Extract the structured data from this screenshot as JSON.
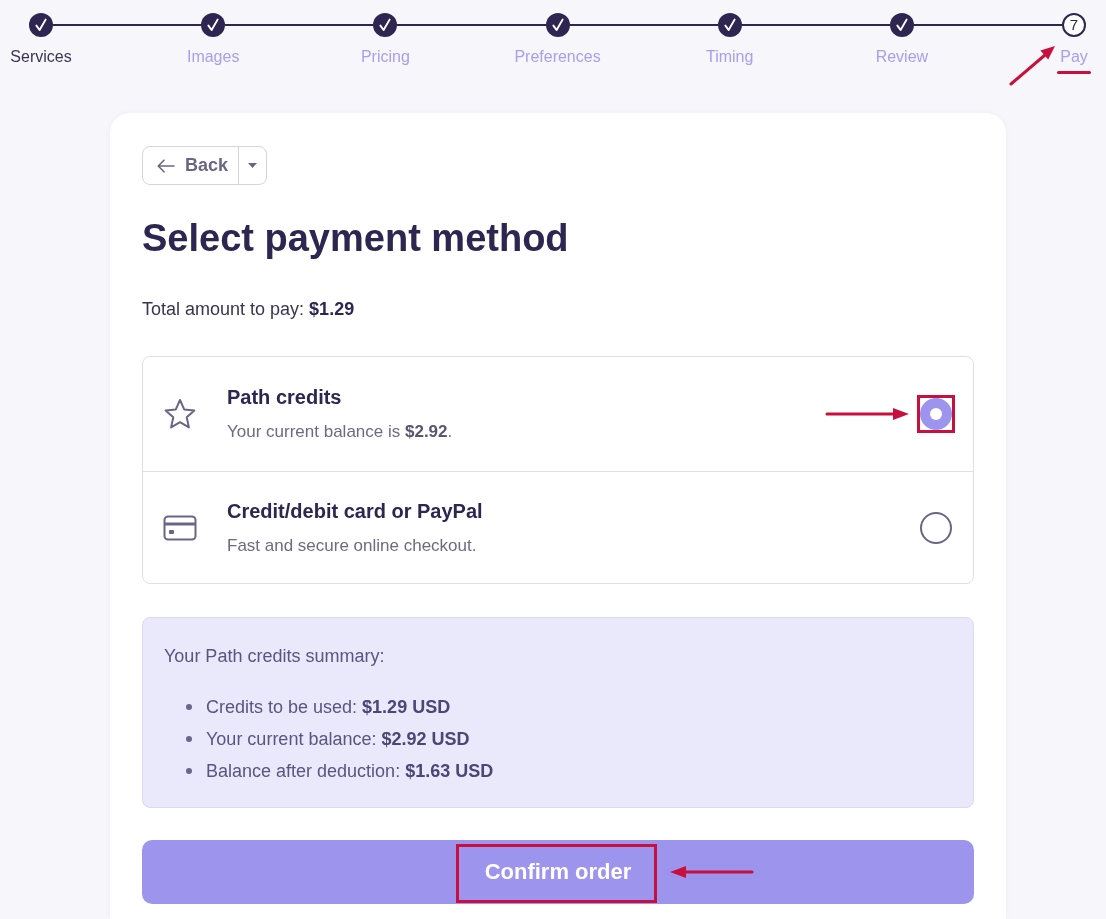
{
  "steps": [
    {
      "label": "Services",
      "done": true,
      "clickable": false,
      "highlighted": false
    },
    {
      "label": "Images",
      "done": true,
      "clickable": true,
      "highlighted": false
    },
    {
      "label": "Pricing",
      "done": true,
      "clickable": true,
      "highlighted": false
    },
    {
      "label": "Preferences",
      "done": true,
      "clickable": true,
      "highlighted": false
    },
    {
      "label": "Timing",
      "done": true,
      "clickable": true,
      "highlighted": false
    },
    {
      "label": "Review",
      "done": true,
      "clickable": true,
      "highlighted": false
    },
    {
      "label": "Pay",
      "number": "7",
      "done": false,
      "clickable": true,
      "highlighted": true
    }
  ],
  "back_button": {
    "label": "Back"
  },
  "title": "Select payment method",
  "total": "Total amount to pay: **$1.29**",
  "methods": [
    {
      "kind": "credits",
      "title": "Path credits",
      "subtitle": "Your current balance is **$2.92**.",
      "selected": true,
      "highlighted": true
    },
    {
      "kind": "card",
      "title": "Credit/debit card or PayPal",
      "subtitle": "Fast and secure online checkout.",
      "selected": false,
      "highlighted": false
    }
  ],
  "summary": {
    "heading": "Your Path credits summary:",
    "items": [
      "Credits to be used: **$1.29 USD**",
      "Your current balance: **$2.92 USD**",
      "Balance after deduction: **$1.63 USD**"
    ]
  },
  "confirm_button": {
    "label": "Confirm order",
    "highlighted": true
  }
}
